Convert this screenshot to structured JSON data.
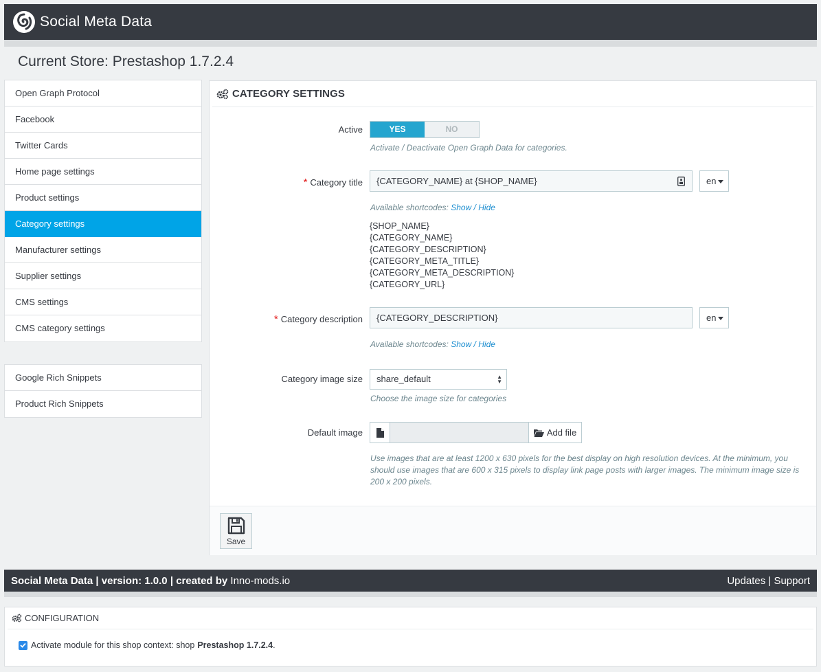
{
  "topbar": {
    "title": "Social Meta Data"
  },
  "store": {
    "title": "Current Store: Prestashop 1.7.2.4"
  },
  "nav_primary": [
    "Open Graph Protocol",
    "Facebook",
    "Twitter Cards",
    "Home page settings",
    "Product settings",
    "Category settings",
    "Manufacturer settings",
    "Supplier settings",
    "CMS settings",
    "CMS category settings"
  ],
  "nav_primary_active": "Category settings",
  "nav_secondary": [
    "Google Rich Snippets",
    "Product Rich Snippets"
  ],
  "panel": {
    "heading": "CATEGORY SETTINGS",
    "active": {
      "label": "Active",
      "yes": "YES",
      "no": "NO",
      "selected": "YES",
      "help": "Activate / Deactivate Open Graph Data for categories."
    },
    "category_title": {
      "label": "Category title",
      "value": "{CATEGORY_NAME} at {SHOP_NAME}",
      "lang": "en",
      "help_prefix": "Available shortcodes: ",
      "show": "Show",
      "sep": " / ",
      "hide": "Hide",
      "shortcodes": [
        "{SHOP_NAME}",
        "{CATEGORY_NAME}",
        "{CATEGORY_DESCRIPTION}",
        "{CATEGORY_META_TITLE}",
        "{CATEGORY_META_DESCRIPTION}",
        "{CATEGORY_URL}"
      ]
    },
    "category_description": {
      "label": "Category description",
      "value": "{CATEGORY_DESCRIPTION}",
      "lang": "en",
      "help_prefix": "Available shortcodes: ",
      "show": "Show",
      "sep": " / ",
      "hide": "Hide"
    },
    "image_size": {
      "label": "Category image size",
      "value": "share_default",
      "help": "Choose the image size for categories"
    },
    "default_image": {
      "label": "Default image",
      "button": "Add file",
      "help": "Use images that are at least 1200 x 630 pixels for the best display on high resolution devices. At the minimum, you should use images that are 600 x 315 pixels to display link page posts with larger images. The minimum image size is 200 x 200 pixels."
    },
    "save": "Save"
  },
  "footer": {
    "name": "Social Meta Data",
    "sep1": " | ",
    "version": "version: 1.0.0",
    "sep2": " | ",
    "created": "created by ",
    "author": "Inno-mods.io",
    "updates": "Updates",
    "sep3": " | ",
    "support": "Support"
  },
  "config": {
    "heading": "CONFIGURATION",
    "checkbox_text": "Activate module for this shop context: shop ",
    "shop": "Prestashop 1.7.2.4",
    "period": ".",
    "checked": true
  },
  "colors": {
    "accent": "#00a4e7",
    "dark": "#363a41",
    "switch_on": "#25a5cf",
    "required": "#e21b1b",
    "link": "#1d8ed0"
  }
}
